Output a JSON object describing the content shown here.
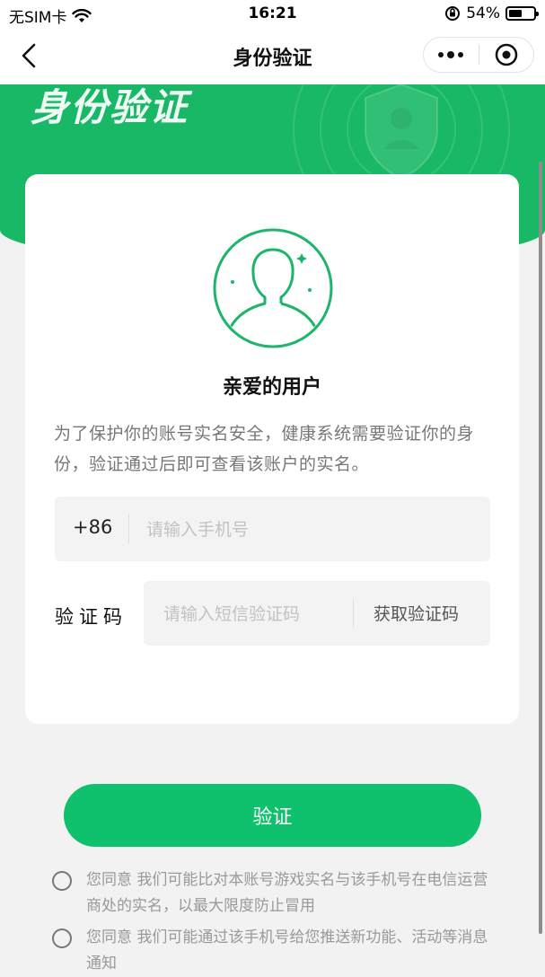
{
  "status_bar": {
    "carrier": "无SIM卡",
    "time": "16:21",
    "battery_percent": "54%",
    "battery_level": 0.54
  },
  "nav": {
    "title": "身份验证",
    "back_icon": "chevron-left-icon",
    "more_icon": "more-dots-icon",
    "close_icon": "target-circle-icon"
  },
  "banner": {
    "title": "身份验证"
  },
  "card": {
    "greeting": "亲爱的用户",
    "description": "为了保护你的账号实名安全，健康系统需要验证你的身份，验证通过后即可查看该账户的实名。",
    "phone": {
      "country_code": "+86",
      "placeholder": "请输入手机号"
    },
    "code": {
      "label": "验证码",
      "placeholder": "请输入短信验证码",
      "get_code_label": "获取验证码"
    }
  },
  "verify_button": "验证",
  "agreements": [
    {
      "text": "您同意 我们可能比对本账号游戏实名与该手机号在电信运营商处的实名，以最大限度防止冒用",
      "checked": false
    },
    {
      "text": "您同意 我们可能通过该手机号给您推送新功能、活动等消息通知",
      "checked": false
    }
  ],
  "colors": {
    "brand_green": "#19b866",
    "button_green": "#0fc16c"
  }
}
